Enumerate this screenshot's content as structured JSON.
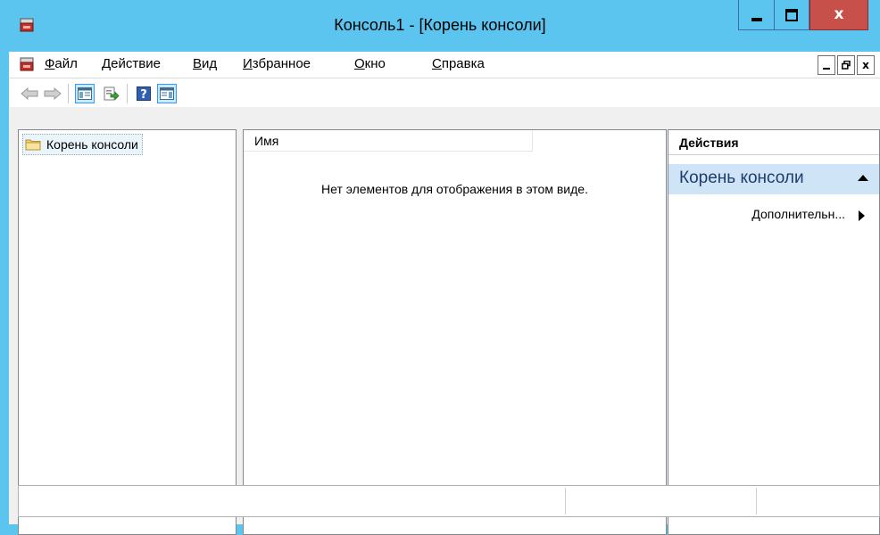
{
  "window": {
    "title": "Консоль1 - [Корень консоли]",
    "minimize_icon": "minimize-icon",
    "maximize_icon": "maximize-icon",
    "close_label": "x"
  },
  "menu": {
    "items": [
      {
        "accel": "Ф",
        "rest": "айл"
      },
      {
        "accel": "Д",
        "rest": "ействие"
      },
      {
        "accel": "В",
        "rest": "ид"
      },
      {
        "accel": "И",
        "rest": "збранное"
      },
      {
        "accel": "О",
        "rest": "кно"
      },
      {
        "accel": "С",
        "rest": "правка"
      }
    ],
    "mdi_restore_label": "Ꞓ",
    "mdi_close_label": "x"
  },
  "toolbar": {
    "icons": [
      "back-arrow-icon",
      "forward-arrow-icon",
      "show-hide-console-tree-icon",
      "export-list-icon",
      "help-icon",
      "show-hide-action-pane-icon"
    ]
  },
  "tree": {
    "root_label": "Корень консоли"
  },
  "list": {
    "column_name": "Имя",
    "empty_message": "Нет элементов для отображения в этом виде."
  },
  "actions": {
    "header": "Действия",
    "group_title": "Корень консоли",
    "item_label": "Дополнительн..."
  },
  "colors": {
    "frame": "#5bc4ef",
    "close_button": "#c7504b",
    "actions_group_bg": "#cfe4f7"
  }
}
